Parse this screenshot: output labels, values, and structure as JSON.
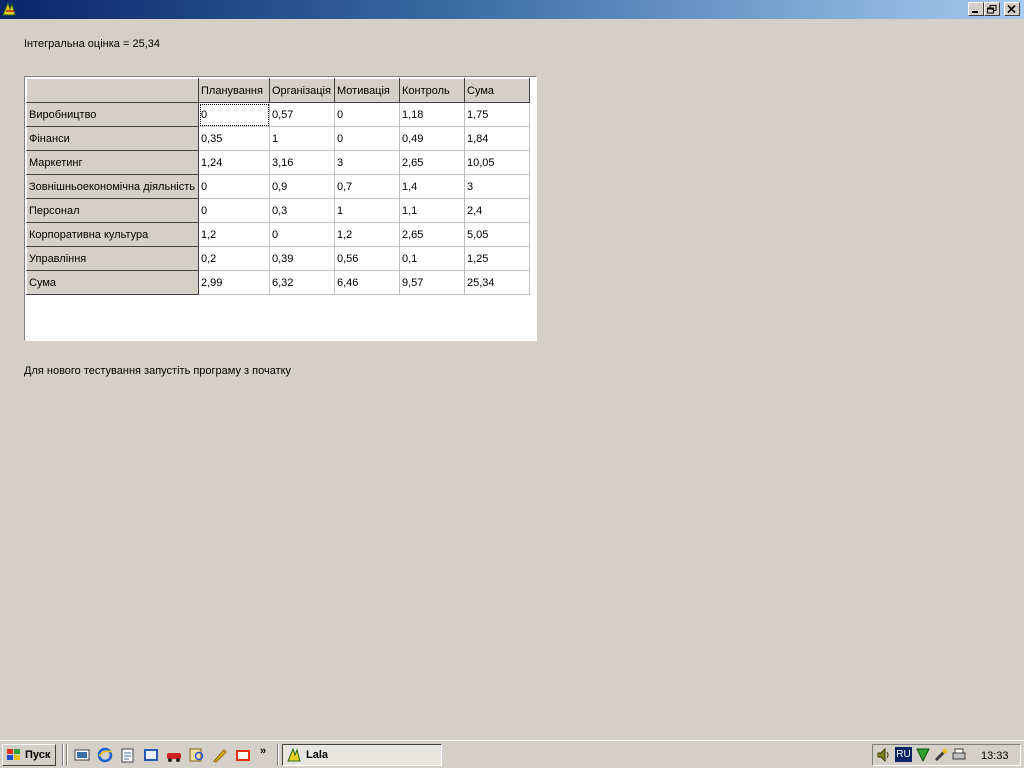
{
  "window": {
    "icons": {
      "app": "app-logo-icon",
      "minimize": "minimize-icon",
      "restore": "restore-icon",
      "close": "close-icon"
    }
  },
  "score_text": "Інтегральна оцінка = 25,34",
  "grid": {
    "headers": [
      "",
      "Планування",
      "Організація",
      "Мотивація",
      "Контроль",
      "Сума"
    ],
    "rows": [
      {
        "label": "Виробництво",
        "values": [
          "0",
          "0,57",
          "0",
          "1,18",
          "1,75"
        ]
      },
      {
        "label": "Фінанси",
        "values": [
          "0,35",
          "1",
          "0",
          "0,49",
          "1,84"
        ]
      },
      {
        "label": "Маркетинг",
        "values": [
          "1,24",
          "3,16",
          "3",
          "2,65",
          "10,05"
        ]
      },
      {
        "label": "Зовнішньоекономічна діяльність",
        "values": [
          "0",
          "0,9",
          "0,7",
          "1,4",
          "3"
        ]
      },
      {
        "label": "Персонал",
        "values": [
          "0",
          "0,3",
          "1",
          "1,1",
          "2,4"
        ]
      },
      {
        "label": "Корпоративна культура",
        "values": [
          "1,2",
          "0",
          "1,2",
          "2,65",
          "5,05"
        ]
      },
      {
        "label": "Управління",
        "values": [
          "0,2",
          "0,39",
          "0,56",
          "0,1",
          "1,25"
        ]
      },
      {
        "label": "Сума",
        "values": [
          "2,99",
          "6,32",
          "6,46",
          "9,57",
          "25,34"
        ]
      }
    ]
  },
  "footer_text": "Для нового тестування  запустіть програму з початку",
  "taskbar": {
    "start_label": "Пуск",
    "chevron": "»",
    "task_label": "Lala",
    "lang": "RU",
    "clock": "13:33",
    "quick_launch_icons": [
      "show-desktop-icon",
      "internet-explorer-icon",
      "notepad-icon",
      "outlook-icon",
      "car-app-icon",
      "search-app-icon",
      "pencil-app-icon",
      "media-app-icon"
    ],
    "tray_icons": [
      "volume-icon",
      "language-icon",
      "network-icon",
      "tool-icon",
      "printer-icon"
    ]
  },
  "colors": {
    "background": "#d4d0c8",
    "title_start": "#0a246a",
    "title_end": "#a6caf0"
  }
}
